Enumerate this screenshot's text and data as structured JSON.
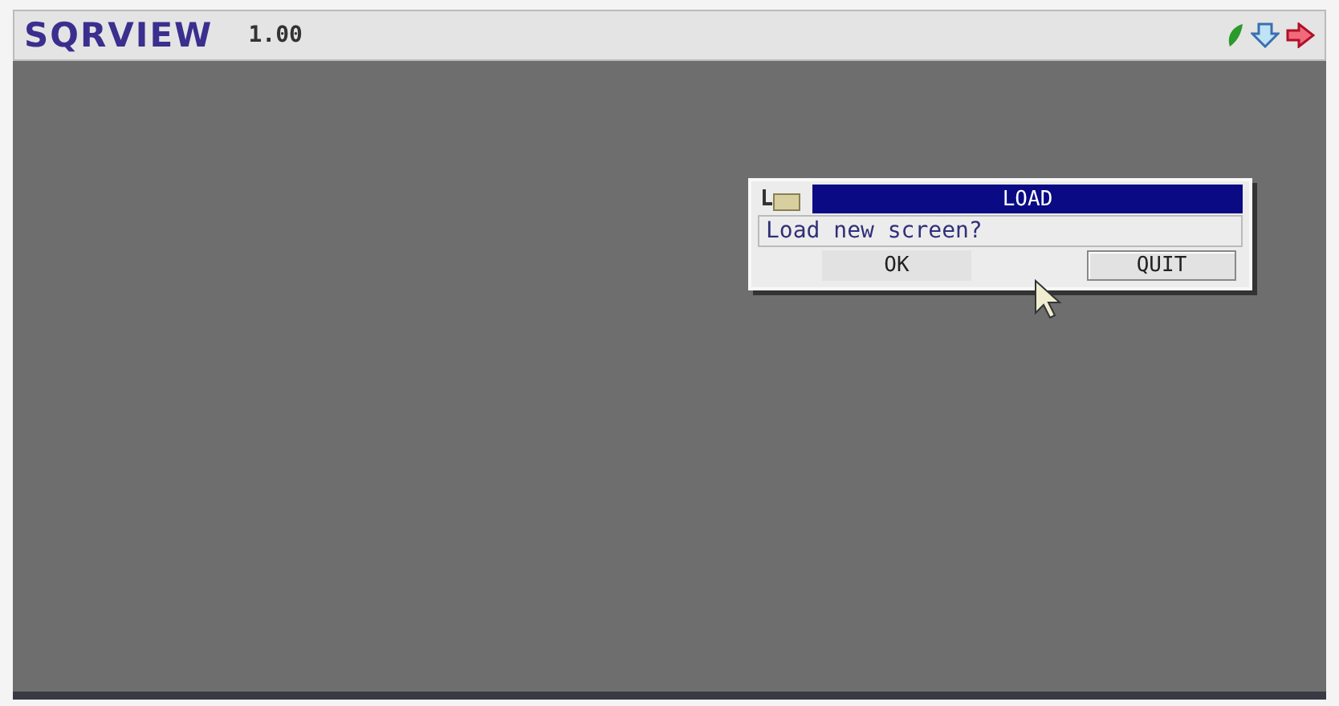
{
  "app": {
    "title": "SQRVIEW",
    "version": "1.00"
  },
  "dialog": {
    "title": "LOAD",
    "message": "Load new screen?",
    "buttons": [
      {
        "label": "OK",
        "selected": false
      },
      {
        "label": "QUIT",
        "selected": true
      }
    ]
  }
}
